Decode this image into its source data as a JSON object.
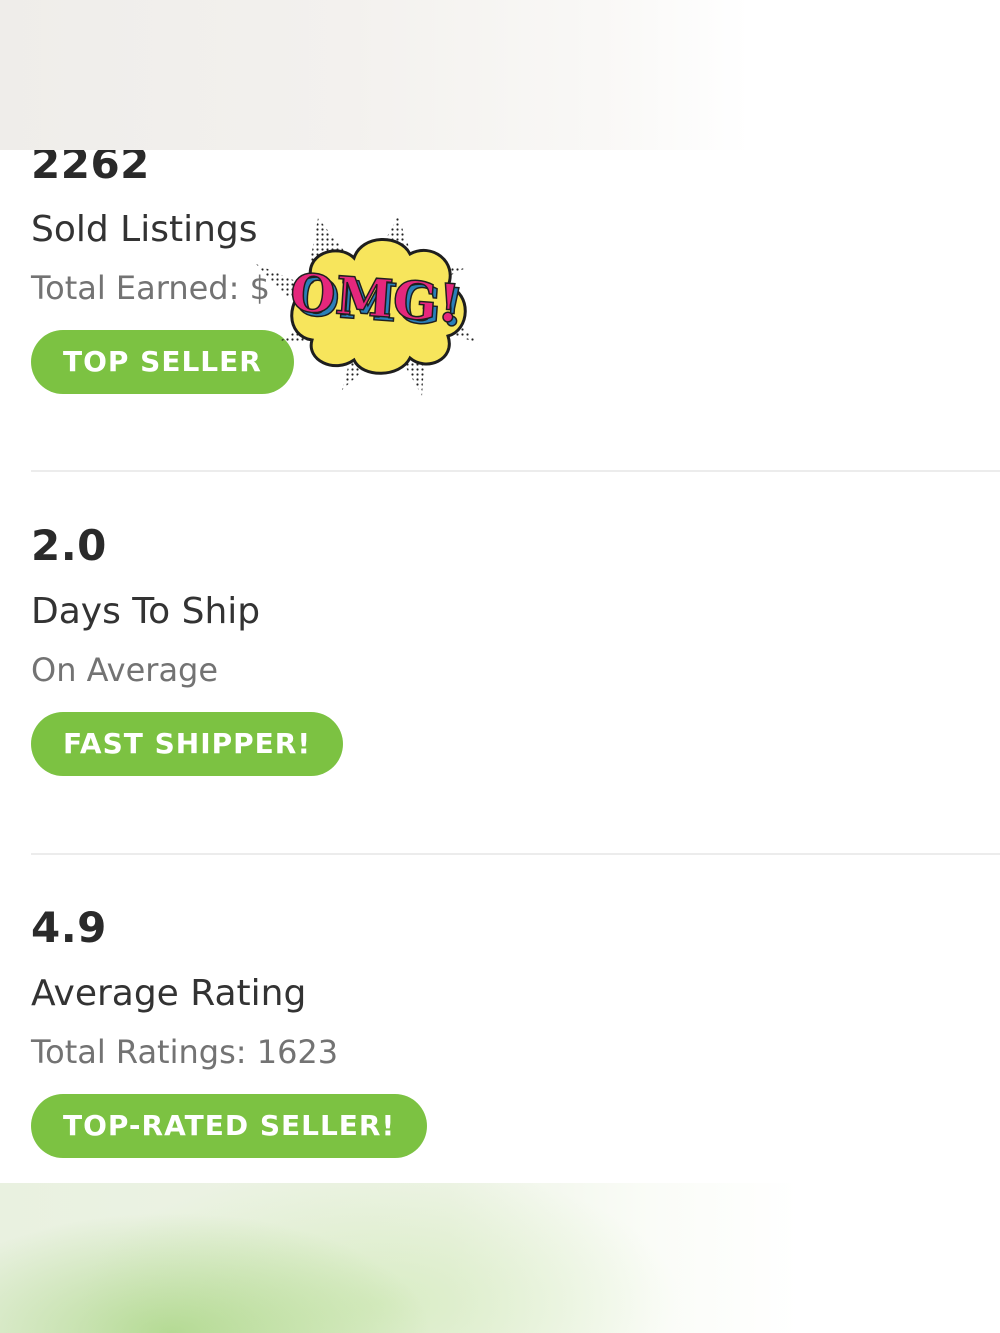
{
  "stats": [
    {
      "value": "2262",
      "label": "Sold Listings",
      "sub": "Total Earned: $",
      "badge": "TOP SELLER"
    },
    {
      "value": "2.0",
      "label": "Days To Ship",
      "sub": "On Average",
      "badge": "FAST SHIPPER!"
    },
    {
      "value": "4.9",
      "label": "Average Rating",
      "sub": "Total Ratings: 1623",
      "badge": "TOP-RATED SELLER!"
    }
  ],
  "sticker": {
    "text": "OMG!"
  },
  "colors": {
    "badge": "#7cc242",
    "value_text": "#2a2a2a",
    "sub_text": "#737373",
    "sticker_cloud": "#f7e55c",
    "sticker_text": "#e5277c",
    "sticker_shadow": "#2a7fb8"
  }
}
